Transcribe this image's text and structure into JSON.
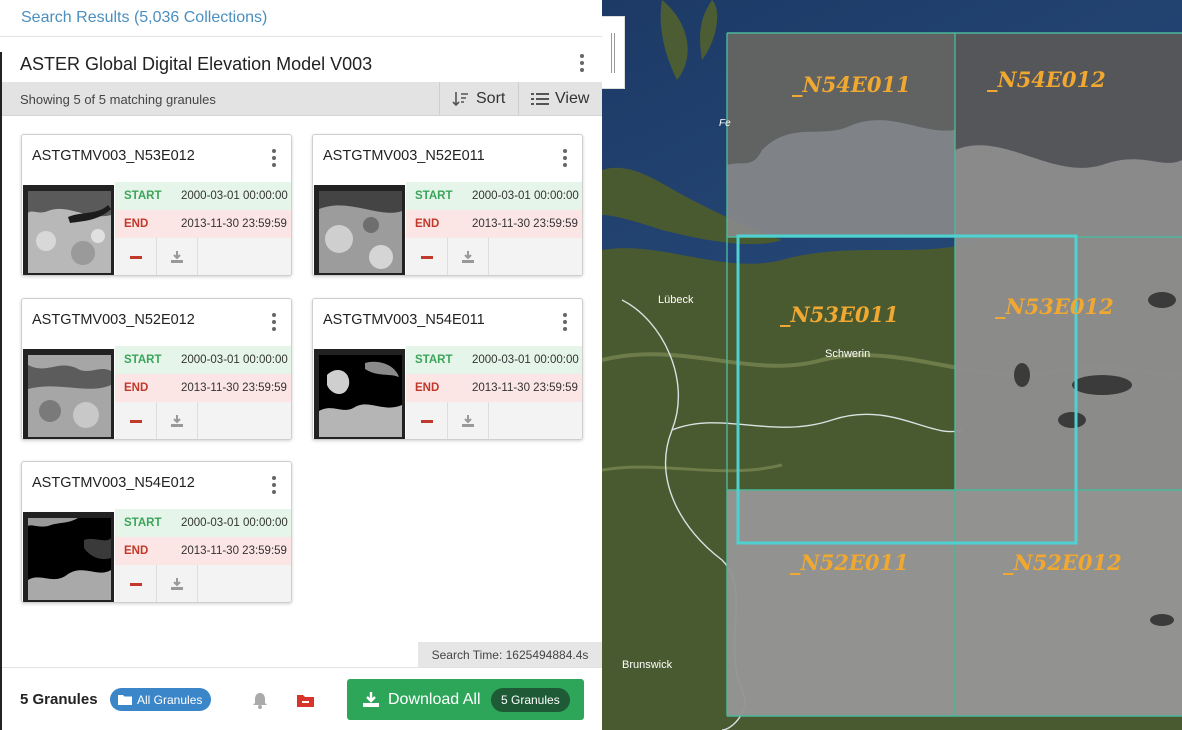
{
  "breadcrumb": {
    "label": "Search Results (5,036 Collections)"
  },
  "collection": {
    "title": "ASTER Global Digital Elevation Model V003"
  },
  "toolbar": {
    "count_text": "Showing 5 of 5 matching granules",
    "sort_label": "Sort",
    "view_label": "View"
  },
  "granules": [
    {
      "name": "ASTGTMV003_N53E012",
      "start_label": "START",
      "start": "2000-03-01 00:00:00",
      "end_label": "END",
      "end": "2013-11-30 23:59:59"
    },
    {
      "name": "ASTGTMV003_N52E011",
      "start_label": "START",
      "start": "2000-03-01 00:00:00",
      "end_label": "END",
      "end": "2013-11-30 23:59:59"
    },
    {
      "name": "ASTGTMV003_N52E012",
      "start_label": "START",
      "start": "2000-03-01 00:00:00",
      "end_label": "END",
      "end": "2013-11-30 23:59:59"
    },
    {
      "name": "ASTGTMV003_N54E011",
      "start_label": "START",
      "start": "2000-03-01 00:00:00",
      "end_label": "END",
      "end": "2013-11-30 23:59:59"
    },
    {
      "name": "ASTGTMV003_N54E012",
      "start_label": "START",
      "start": "2000-03-01 00:00:00",
      "end_label": "END",
      "end": "2013-11-30 23:59:59"
    }
  ],
  "search_time": "Search Time: 1625494884.4s",
  "footer": {
    "granule_count": "5 Granules",
    "all_granules_label": "All Granules",
    "download_label": "Download All",
    "download_count": "5 Granules"
  },
  "map": {
    "tiles": {
      "n54e011": "_N54E011",
      "n54e012": "_N54E012",
      "n53e011": "_N53E011",
      "n53e012": "_N53E012",
      "n52e011": "_N52E011",
      "n52e012": "_N52E012"
    },
    "places": {
      "lubeck": "Lübeck",
      "schwerin": "Schwerin",
      "brunswick": "Brunswick",
      "fe": "Fe"
    }
  },
  "colors": {
    "accent": "#4a8fbf",
    "start_green": "#3aa55a",
    "end_red": "#c0392b",
    "download_green": "#2ea65a",
    "tile_label": "#f0a830",
    "tile_outline": "#3ad6c8"
  },
  "icons": [
    "kebab-menu-icon",
    "sort-icon",
    "list-view-icon",
    "remove-icon",
    "download-icon",
    "folder-icon",
    "bell-icon",
    "folder-remove-icon"
  ]
}
